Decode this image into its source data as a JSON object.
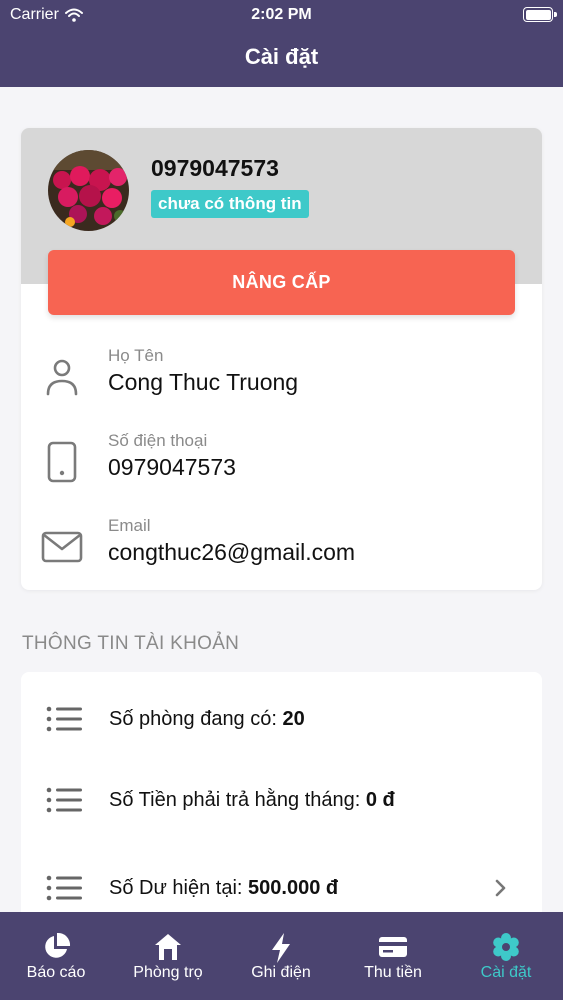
{
  "status_bar": {
    "carrier": "Carrier",
    "time": "2:02 PM"
  },
  "nav": {
    "title": "Cài đặt"
  },
  "profile": {
    "phone": "0979047573",
    "badge": "chưa có thông tin",
    "upgrade_label": "NÂNG CẤP",
    "fields": [
      {
        "label": "Họ Tên",
        "value": "Cong Thuc Truong",
        "icon": "person-icon"
      },
      {
        "label": "Số điện thoại",
        "value": "0979047573",
        "icon": "phone-icon"
      },
      {
        "label": "Email",
        "value": "congthuc26@gmail.com",
        "icon": "mail-icon"
      }
    ]
  },
  "account": {
    "section_title": "THÔNG TIN TÀI KHOẢN",
    "rows": [
      {
        "label": "Số phòng đang có: ",
        "value": "20",
        "icon": "list-icon"
      },
      {
        "label": "Số Tiền phải trả hằng tháng: ",
        "value": "0 đ",
        "icon": "list-icon"
      },
      {
        "label": "Số Dư hiện tại: ",
        "value": "500.000 đ",
        "icon": "list-icon",
        "has_chevron": true
      }
    ]
  },
  "tabbar": {
    "tabs": [
      {
        "label": "Báo cáo",
        "icon": "pie-chart-icon"
      },
      {
        "label": "Phòng trọ",
        "icon": "house-icon"
      },
      {
        "label": "Ghi điện",
        "icon": "lightning-icon"
      },
      {
        "label": "Thu tiền",
        "icon": "card-icon"
      },
      {
        "label": "Cài đặt",
        "icon": "gear-icon",
        "active": true
      }
    ]
  },
  "colors": {
    "header": "#4b4470",
    "accent": "#3ec9c9",
    "upgrade": "#f76452",
    "profile_bg": "#d7d7d7"
  }
}
